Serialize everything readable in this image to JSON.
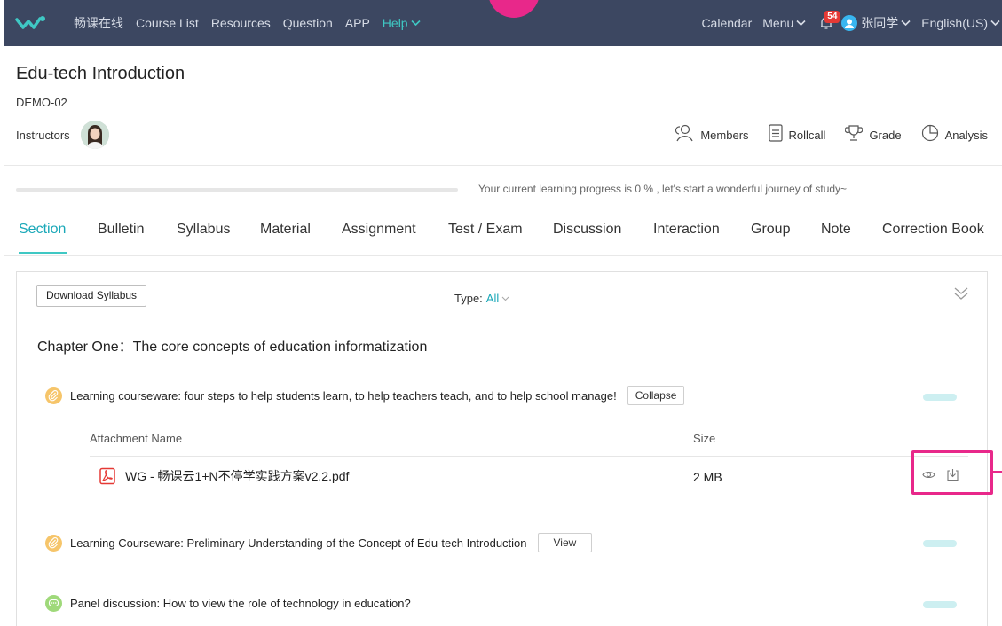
{
  "nav": {
    "brand": "畅课在线",
    "items": [
      "Course List",
      "Resources",
      "Question",
      "APP"
    ],
    "help": "Help",
    "calendar": "Calendar",
    "menu": "Menu",
    "notification_count": "54",
    "user": "张同学",
    "language": "English(US)"
  },
  "course": {
    "title": "Edu-tech Introduction",
    "code": "DEMO-02",
    "instructors_label": "Instructors"
  },
  "tools": {
    "members": "Members",
    "rollcall": "Rollcall",
    "grade": "Grade",
    "analysis": "Analysis"
  },
  "progress": {
    "percent": 0,
    "text": "Your current learning progress is 0 % , let's start a wonderful journey of study~"
  },
  "tabs": [
    "Section",
    "Bulletin",
    "Syllabus",
    "Material",
    "Assignment",
    "Test / Exam",
    "Discussion",
    "Interaction",
    "Group",
    "Note",
    "Correction Book"
  ],
  "panel": {
    "download_label": "Download Syllabus",
    "type_label": "Type:",
    "type_value": "All",
    "chapter_title": "Chapter One：The core concepts of education informatization",
    "items": [
      {
        "title": "Learning courseware: four steps to help students learn, to help teachers teach, and to help school manage!",
        "button": "Collapse"
      },
      {
        "title": "Learning Courseware: Preliminary Understanding of the Concept of Edu-tech Introduction",
        "button": "View"
      },
      {
        "title": "Panel discussion: How to view the role of technology in education?"
      }
    ],
    "attachment": {
      "name_header": "Attachment Name",
      "size_header": "Size",
      "file_name": "WG - 畅课云1+N不停学实践方案v2.2.pdf",
      "file_size": "2 MB"
    }
  },
  "colors": {
    "nav_bg": "#3c4761",
    "accent": "#3fc8c4",
    "highlight": "#e8288a",
    "badge": "#e53935"
  }
}
